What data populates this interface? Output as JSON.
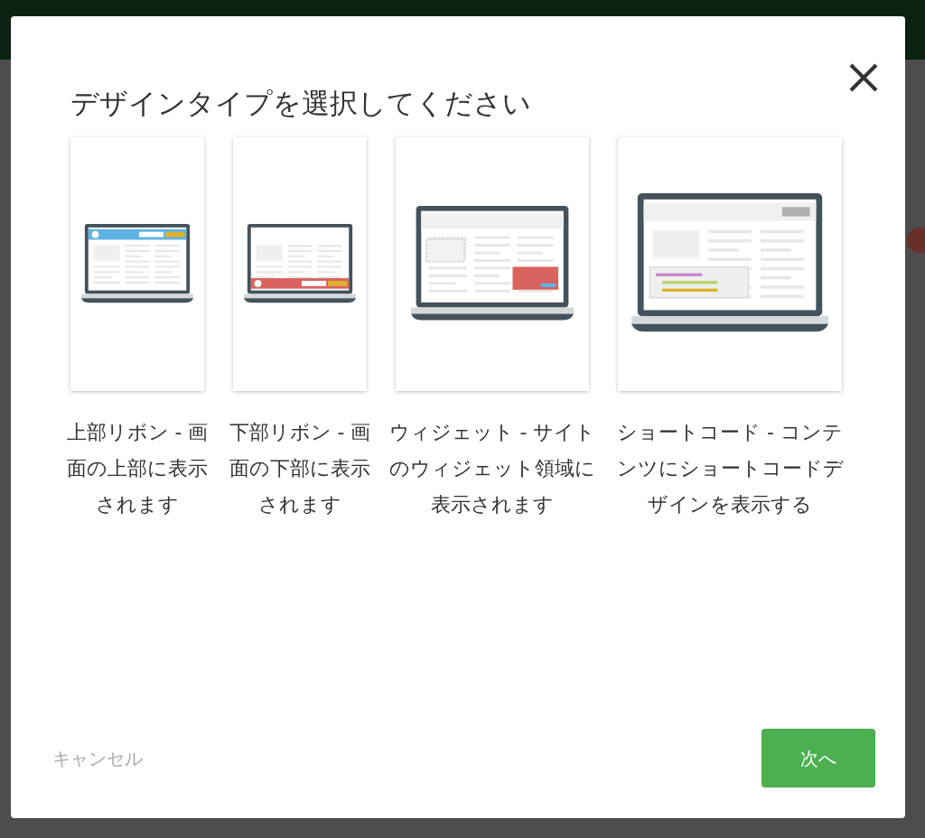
{
  "dialog": {
    "title": "デザインタイプを選択してください",
    "options": [
      {
        "kind": "top-ribbon",
        "label": "上部リボン - 画面の上部に表示されます",
        "selected": false
      },
      {
        "kind": "bottom-ribbon",
        "label": "下部リボン - 画面の下部に表示されます",
        "selected": false
      },
      {
        "kind": "widget",
        "label": "ウィジェット - サイトのウィジェット領域に表示されます",
        "selected": false
      },
      {
        "kind": "shortcode",
        "label": "ショートコード - コンテンツにショートコードデザインを表示する",
        "selected": false
      }
    ],
    "cancel": "キャンセル",
    "next": "次へ"
  }
}
